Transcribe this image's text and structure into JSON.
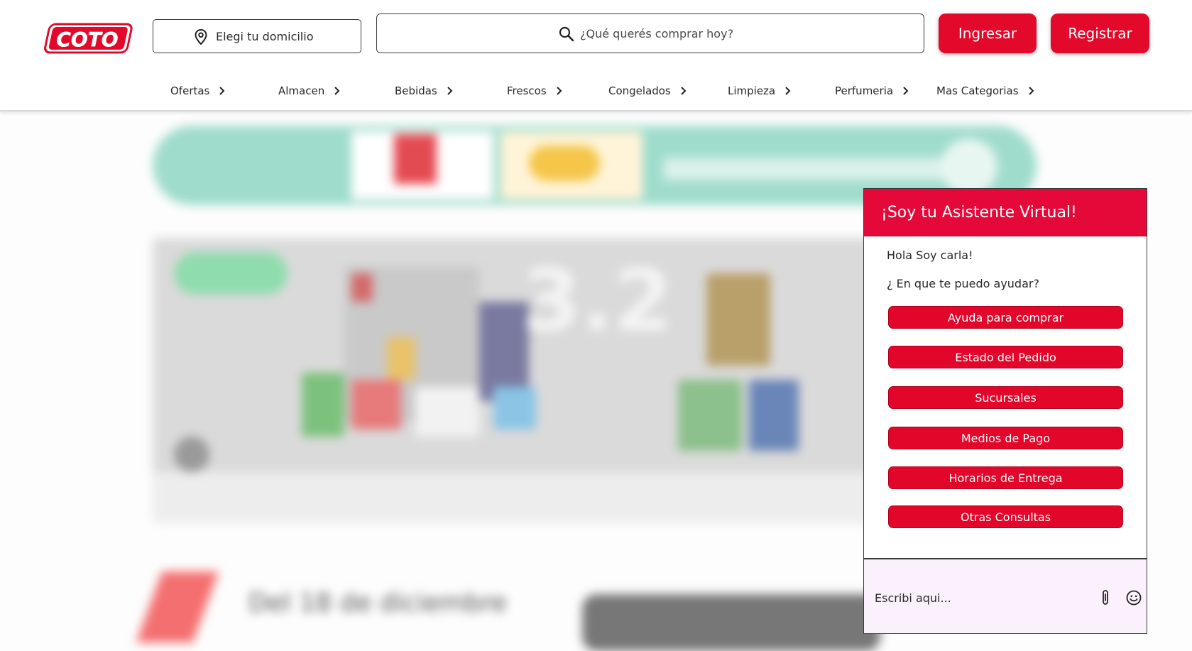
{
  "header": {
    "logo_text": "COTO",
    "location_label": "Elegi tu domicilio",
    "search_placeholder": "¿Qué querés comprar hoy?",
    "login_label": "Ingresar",
    "register_label": "Registrar",
    "brand_color": "#e2092b"
  },
  "nav": {
    "items": [
      {
        "label": "Ofertas"
      },
      {
        "label": "Almacen"
      },
      {
        "label": "Bebidas"
      },
      {
        "label": "Frescos"
      },
      {
        "label": "Congelados"
      },
      {
        "label": "Limpieza"
      },
      {
        "label": "Perfumeria"
      },
      {
        "label": "Mas Categorias"
      }
    ],
    "chevron_icon": "chevron-right-icon"
  },
  "background": {
    "banner_number": "3.2",
    "banner3_text": "Del 18 de diciembre"
  },
  "chat": {
    "title": "¡Soy tu Asistente Virtual!",
    "greeting": "Hola Soy carla!",
    "question": "¿ En que te puedo ayudar?",
    "options": [
      {
        "label": "Ayuda para comprar"
      },
      {
        "label": "Estado del Pedido"
      },
      {
        "label": "Sucursales"
      },
      {
        "label": "Medios de Pago"
      },
      {
        "label": "Horarios de Entrega"
      },
      {
        "label": "Otras Consultas"
      }
    ],
    "input_placeholder": "Escribi aqui...",
    "attach_icon": "paperclip-icon",
    "emoji_icon": "smiley-icon",
    "accent_color": "#e5093a"
  }
}
